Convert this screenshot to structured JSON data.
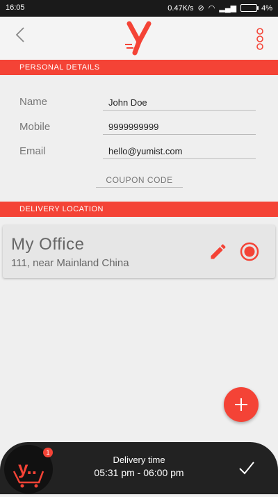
{
  "status_bar": {
    "time": "16:05",
    "speed": "0.47K/s",
    "battery": "4%"
  },
  "sections": {
    "personal": "PERSONAL DETAILS",
    "delivery": "DELIVERY LOCATION"
  },
  "personal": {
    "name_label": "Name",
    "name_value": "John Doe",
    "mobile_label": "Mobile",
    "mobile_value": "9999999999",
    "email_label": "Email",
    "email_value": "hello@yumist.com",
    "coupon_label": "COUPON CODE"
  },
  "location": {
    "name": "My Office",
    "address": "111, near Mainland China"
  },
  "cart": {
    "badge": "1",
    "logo_text": "y.."
  },
  "delivery": {
    "title": "Delivery time",
    "time": "05:31 pm - 06:00 pm"
  },
  "colors": {
    "accent": "#f44336",
    "header_bg": "#f4f4f4",
    "bottom_bar": "#222222"
  },
  "icons": {
    "back": "chevron-left-icon",
    "menu": "more-vertical-icon",
    "edit": "pencil-icon",
    "radio": "radio-selected-icon",
    "add": "plus-icon",
    "confirm": "check-icon"
  }
}
